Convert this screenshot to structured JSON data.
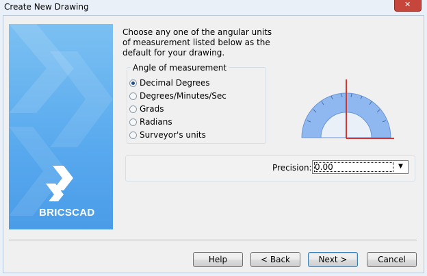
{
  "window": {
    "title": "Create New Drawing",
    "close_label": "✕"
  },
  "brand": {
    "name": "BRICSCAD"
  },
  "intro": {
    "text": "Choose any one of the angular units of measurement listed below as the default for your drawing."
  },
  "angle_group": {
    "label": "Angle of measurement",
    "options": [
      {
        "label": "Decimal Degrees",
        "checked": true
      },
      {
        "label": "Degrees/Minutes/Sec",
        "checked": false
      },
      {
        "label": "Grads",
        "checked": false
      },
      {
        "label": "Radians",
        "checked": false
      },
      {
        "label": "Surveyor's units",
        "checked": false
      }
    ]
  },
  "precision": {
    "label": "Precision:",
    "value": "0.00"
  },
  "buttons": {
    "help": "Help",
    "back": "< Back",
    "next": "Next >",
    "cancel": "Cancel"
  },
  "colors": {
    "accent": "#4a9ce8",
    "protractor_fill": "#8fb8f0",
    "protractor_axis": "#d9342b"
  },
  "icons": [
    "close-icon",
    "bricscad-logo-icon",
    "protractor-icon",
    "chevron-down-icon"
  ]
}
